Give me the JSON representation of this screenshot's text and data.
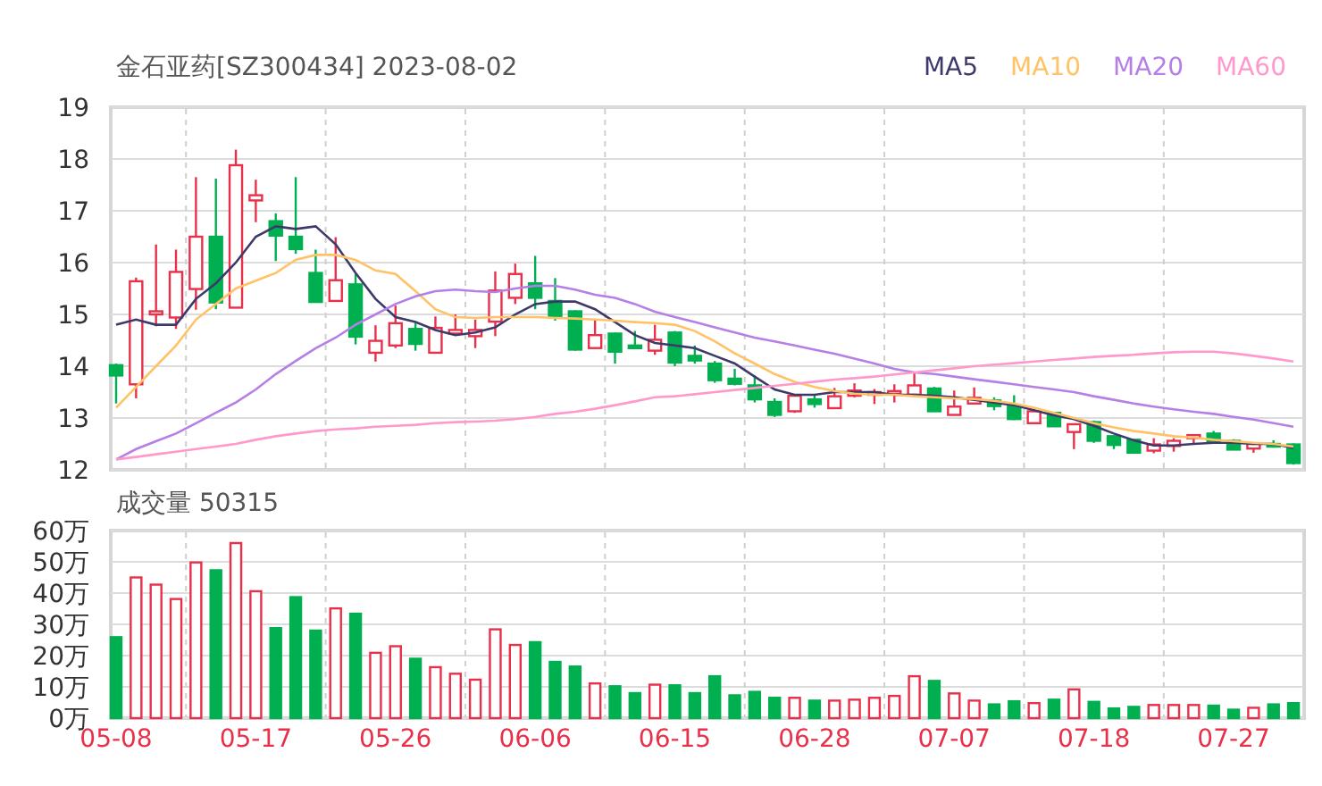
{
  "header": {
    "title": "金石亚药[SZ300434] 2023-08-02"
  },
  "price_chart": {
    "chart_data": {
      "type": "candlestick",
      "grid": true,
      "ylim": [
        12,
        19
      ],
      "yticks": [
        12,
        13,
        14,
        15,
        16,
        17,
        18,
        19
      ],
      "series": [
        {
          "name": "MA5",
          "type": "line",
          "color": "#3d3a6b",
          "values": [
            14.8,
            14.9,
            14.8,
            14.8,
            15.3,
            15.6,
            16.0,
            16.5,
            16.7,
            16.65,
            16.7,
            16.35,
            15.8,
            15.3,
            14.95,
            14.85,
            14.7,
            14.6,
            14.65,
            14.75,
            15.0,
            15.2,
            15.25,
            15.25,
            15.1,
            14.85,
            14.6,
            14.45,
            14.4,
            14.35,
            14.2,
            14.05,
            13.8,
            13.55,
            13.45,
            13.45,
            13.5,
            13.5,
            13.5,
            13.45,
            13.45,
            13.43,
            13.4,
            13.35,
            13.3,
            13.25,
            13.15,
            13.05,
            12.98,
            12.85,
            12.7,
            12.57,
            12.47,
            12.47,
            12.5,
            12.52,
            12.52,
            12.5,
            12.5,
            12.42
          ]
        },
        {
          "name": "MA10",
          "type": "line",
          "color": "#ffc266",
          "values": [
            13.2,
            13.6,
            14.0,
            14.4,
            14.9,
            15.2,
            15.5,
            15.65,
            15.8,
            16.05,
            16.15,
            16.15,
            16.05,
            15.85,
            15.78,
            15.45,
            15.1,
            14.95,
            14.93,
            14.95,
            14.95,
            14.95,
            14.93,
            14.92,
            14.9,
            14.88,
            14.85,
            14.83,
            14.8,
            14.68,
            14.48,
            14.25,
            14.05,
            13.85,
            13.7,
            13.6,
            13.52,
            13.47,
            13.45,
            13.45,
            13.42,
            13.4,
            13.38,
            13.37,
            13.33,
            13.28,
            13.2,
            13.1,
            13.0,
            12.9,
            12.82,
            12.75,
            12.7,
            12.65,
            12.62,
            12.58,
            12.55,
            12.52,
            12.5,
            12.45
          ]
        },
        {
          "name": "MA20",
          "type": "line",
          "color": "#b57fe6",
          "values": [
            12.2,
            12.4,
            12.55,
            12.7,
            12.9,
            13.1,
            13.3,
            13.55,
            13.85,
            14.1,
            14.35,
            14.55,
            14.8,
            15.0,
            15.2,
            15.35,
            15.45,
            15.48,
            15.45,
            15.43,
            15.5,
            15.55,
            15.55,
            15.48,
            15.38,
            15.32,
            15.2,
            15.05,
            14.95,
            14.85,
            14.75,
            14.65,
            14.55,
            14.48,
            14.4,
            14.32,
            14.24,
            14.15,
            14.05,
            13.95,
            13.88,
            13.85,
            13.8,
            13.75,
            13.7,
            13.65,
            13.6,
            13.55,
            13.5,
            13.42,
            13.35,
            13.28,
            13.22,
            13.17,
            13.12,
            13.08,
            13.02,
            12.97,
            12.9,
            12.83
          ]
        },
        {
          "name": "MA60",
          "type": "line",
          "color": "#ff99cc",
          "values": [
            12.2,
            12.25,
            12.3,
            12.35,
            12.4,
            12.45,
            12.5,
            12.58,
            12.65,
            12.7,
            12.75,
            12.78,
            12.8,
            12.83,
            12.85,
            12.87,
            12.9,
            12.92,
            12.93,
            12.95,
            12.98,
            13.02,
            13.08,
            13.12,
            13.18,
            13.25,
            13.32,
            13.4,
            13.42,
            13.46,
            13.5,
            13.54,
            13.58,
            13.62,
            13.66,
            13.7,
            13.74,
            13.77,
            13.8,
            13.84,
            13.88,
            13.92,
            13.96,
            14.0,
            14.03,
            14.06,
            14.09,
            14.12,
            14.15,
            14.18,
            14.2,
            14.22,
            14.25,
            14.27,
            14.28,
            14.28,
            14.25,
            14.2,
            14.15,
            14.09
          ]
        }
      ],
      "ohlc": [
        [
          14.02,
          14.05,
          13.28,
          13.82
        ],
        [
          13.65,
          15.71,
          13.38,
          15.64
        ],
        [
          15.0,
          16.35,
          14.77,
          15.06
        ],
        [
          14.94,
          16.25,
          14.72,
          15.82
        ],
        [
          15.49,
          17.65,
          15.09,
          16.5
        ],
        [
          16.5,
          17.62,
          15.1,
          15.23
        ],
        [
          15.13,
          18.18,
          15.13,
          17.88
        ],
        [
          17.2,
          17.6,
          16.78,
          17.3
        ],
        [
          16.8,
          16.95,
          16.03,
          16.52
        ],
        [
          16.5,
          17.65,
          16.17,
          16.26
        ],
        [
          15.8,
          16.25,
          15.24,
          15.24
        ],
        [
          15.26,
          16.49,
          15.26,
          15.66
        ],
        [
          15.58,
          15.78,
          14.42,
          14.57
        ],
        [
          14.26,
          14.79,
          14.09,
          14.49
        ],
        [
          14.4,
          15.17,
          14.35,
          14.83
        ],
        [
          14.72,
          14.84,
          14.3,
          14.43
        ],
        [
          14.26,
          14.96,
          14.26,
          14.74
        ],
        [
          14.63,
          15.0,
          14.6,
          14.7
        ],
        [
          14.58,
          14.9,
          14.35,
          14.7
        ],
        [
          14.86,
          15.83,
          14.58,
          15.46
        ],
        [
          15.32,
          15.98,
          15.2,
          15.78
        ],
        [
          15.6,
          16.13,
          15.1,
          15.32
        ],
        [
          15.26,
          15.7,
          14.88,
          14.97
        ],
        [
          15.06,
          15.08,
          14.3,
          14.32
        ],
        [
          14.35,
          14.88,
          14.35,
          14.6
        ],
        [
          14.63,
          14.65,
          14.05,
          14.28
        ],
        [
          14.4,
          14.68,
          14.35,
          14.36
        ],
        [
          14.3,
          14.8,
          14.22,
          14.51
        ],
        [
          14.65,
          14.68,
          14.0,
          14.07
        ],
        [
          14.2,
          14.4,
          14.05,
          14.11
        ],
        [
          14.05,
          14.1,
          13.68,
          13.73
        ],
        [
          13.76,
          13.95,
          13.63,
          13.66
        ],
        [
          13.63,
          13.82,
          13.3,
          13.36
        ],
        [
          13.31,
          13.38,
          13.02,
          13.06
        ],
        [
          13.13,
          13.45,
          13.1,
          13.43
        ],
        [
          13.36,
          13.45,
          13.2,
          13.27
        ],
        [
          13.19,
          13.58,
          13.19,
          13.42
        ],
        [
          13.43,
          13.67,
          13.4,
          13.53
        ],
        [
          13.45,
          13.56,
          13.27,
          13.5
        ],
        [
          13.47,
          13.65,
          13.3,
          13.52
        ],
        [
          13.45,
          13.86,
          13.4,
          13.63
        ],
        [
          13.57,
          13.6,
          13.12,
          13.13
        ],
        [
          13.06,
          13.53,
          13.06,
          13.22
        ],
        [
          13.28,
          13.59,
          13.26,
          13.39
        ],
        [
          13.34,
          13.4,
          13.15,
          13.23
        ],
        [
          13.22,
          13.44,
          12.96,
          12.98
        ],
        [
          12.9,
          13.18,
          12.9,
          13.13
        ],
        [
          13.1,
          13.12,
          12.84,
          12.84
        ],
        [
          12.73,
          12.88,
          12.4,
          12.88
        ],
        [
          12.92,
          12.95,
          12.52,
          12.56
        ],
        [
          12.65,
          12.67,
          12.4,
          12.48
        ],
        [
          12.58,
          12.58,
          12.31,
          12.33
        ],
        [
          12.37,
          12.61,
          12.32,
          12.49
        ],
        [
          12.46,
          12.61,
          12.35,
          12.56
        ],
        [
          12.61,
          12.68,
          12.49,
          12.67
        ],
        [
          12.7,
          12.75,
          12.52,
          12.53
        ],
        [
          12.56,
          12.59,
          12.38,
          12.39
        ],
        [
          12.41,
          12.52,
          12.33,
          12.5
        ],
        [
          12.5,
          12.57,
          12.43,
          12.46
        ],
        [
          12.49,
          12.51,
          12.1,
          12.13
        ]
      ]
    }
  },
  "volume_chart": {
    "title": "成交量 50315",
    "chart_data": {
      "type": "bar",
      "grid": true,
      "ylim": [
        0,
        60
      ],
      "yticks": [
        {
          "value": 0,
          "label": "0万"
        },
        {
          "value": 10,
          "label": "10万"
        },
        {
          "value": 20,
          "label": "20万"
        },
        {
          "value": 30,
          "label": "30万"
        },
        {
          "value": 40,
          "label": "40万"
        },
        {
          "value": 50,
          "label": "50万"
        },
        {
          "value": 60,
          "label": "60万"
        }
      ],
      "categories": [
        "05-08",
        null,
        null,
        null,
        null,
        null,
        null,
        "05-17",
        null,
        null,
        null,
        null,
        null,
        null,
        "05-26",
        null,
        null,
        null,
        null,
        null,
        null,
        "06-06",
        null,
        null,
        null,
        null,
        null,
        null,
        "06-15",
        null,
        null,
        null,
        null,
        null,
        null,
        "06-28",
        null,
        null,
        null,
        null,
        null,
        null,
        "07-07",
        null,
        null,
        null,
        null,
        null,
        null,
        "07-18",
        null,
        null,
        null,
        null,
        null,
        null,
        "07-27",
        null,
        null,
        null
      ],
      "values": [
        25.9,
        45,
        42.7,
        38.1,
        49.8,
        47.3,
        56,
        40.6,
        28.8,
        38.7,
        28,
        35.1,
        33.4,
        20.9,
        23,
        19,
        16.3,
        14.2,
        12.3,
        28.4,
        23.4,
        24.3,
        18,
        16.5,
        11.1,
        10.2,
        8,
        10.7,
        10.5,
        8,
        13.4,
        7.3,
        8.4,
        6.5,
        6.5,
        5.6,
        5.6,
        5.9,
        6.5,
        7.1,
        13.4,
        11.9,
        7.9,
        5.6,
        4.4,
        5.4,
        4.8,
        5.9,
        9.2,
        5.2,
        3.1,
        3.6,
        4.2,
        4.2,
        4.2,
        4,
        2.7,
        3.3,
        4.4,
        4.8
      ]
    }
  }
}
